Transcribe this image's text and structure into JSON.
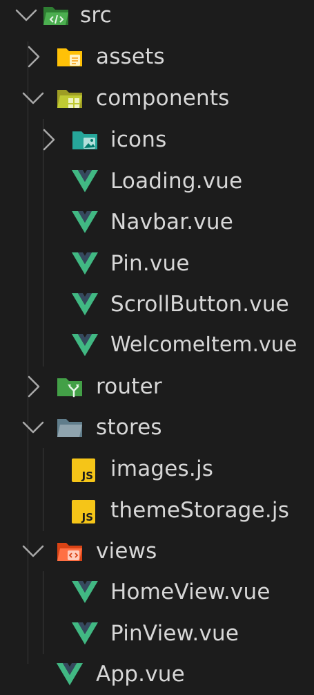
{
  "explorer": {
    "src": {
      "label": "src",
      "icon": "folder-src-open-icon",
      "expanded": true
    },
    "assets": {
      "label": "assets",
      "icon": "folder-assets-icon",
      "expanded": false
    },
    "components": {
      "label": "components",
      "icon": "folder-components-open-icon",
      "expanded": true
    },
    "icons": {
      "label": "icons",
      "icon": "folder-images-icon",
      "expanded": false
    },
    "loading": {
      "label": "Loading.vue",
      "icon": "vue-icon"
    },
    "navbar": {
      "label": "Navbar.vue",
      "icon": "vue-icon"
    },
    "pin": {
      "label": "Pin.vue",
      "icon": "vue-icon"
    },
    "scrollbutton": {
      "label": "ScrollButton.vue",
      "icon": "vue-icon"
    },
    "welcomeitem": {
      "label": "WelcomeItem.vue",
      "icon": "vue-icon"
    },
    "router": {
      "label": "router",
      "icon": "folder-router-icon",
      "expanded": false
    },
    "stores": {
      "label": "stores",
      "icon": "folder-open-icon",
      "expanded": true
    },
    "images": {
      "label": "images.js",
      "icon": "javascript-icon"
    },
    "themestorage": {
      "label": "themeStorage.js",
      "icon": "javascript-icon"
    },
    "views": {
      "label": "views",
      "icon": "folder-views-open-icon",
      "expanded": true
    },
    "homeview": {
      "label": "HomeView.vue",
      "icon": "vue-icon"
    },
    "pinview": {
      "label": "PinView.vue",
      "icon": "vue-icon"
    },
    "app": {
      "label": "App.vue",
      "icon": "vue-icon"
    }
  },
  "js_badge_text": "JS",
  "colors": {
    "background": "#1c1c1c",
    "text": "#d7d7d7",
    "chevron": "#a9a9a9",
    "indent_guide": "#3a3a3a",
    "vue_green": "#41b883",
    "vue_dark": "#35495e",
    "js_yellow": "#f5c518",
    "folder_src": "#4caf50",
    "folder_assets": "#ffc107",
    "folder_components": "#c0ca33",
    "folder_images": "#26a69a",
    "folder_router": "#43a047",
    "folder_plain": "#90a4ae",
    "folder_views": "#ff7043"
  }
}
